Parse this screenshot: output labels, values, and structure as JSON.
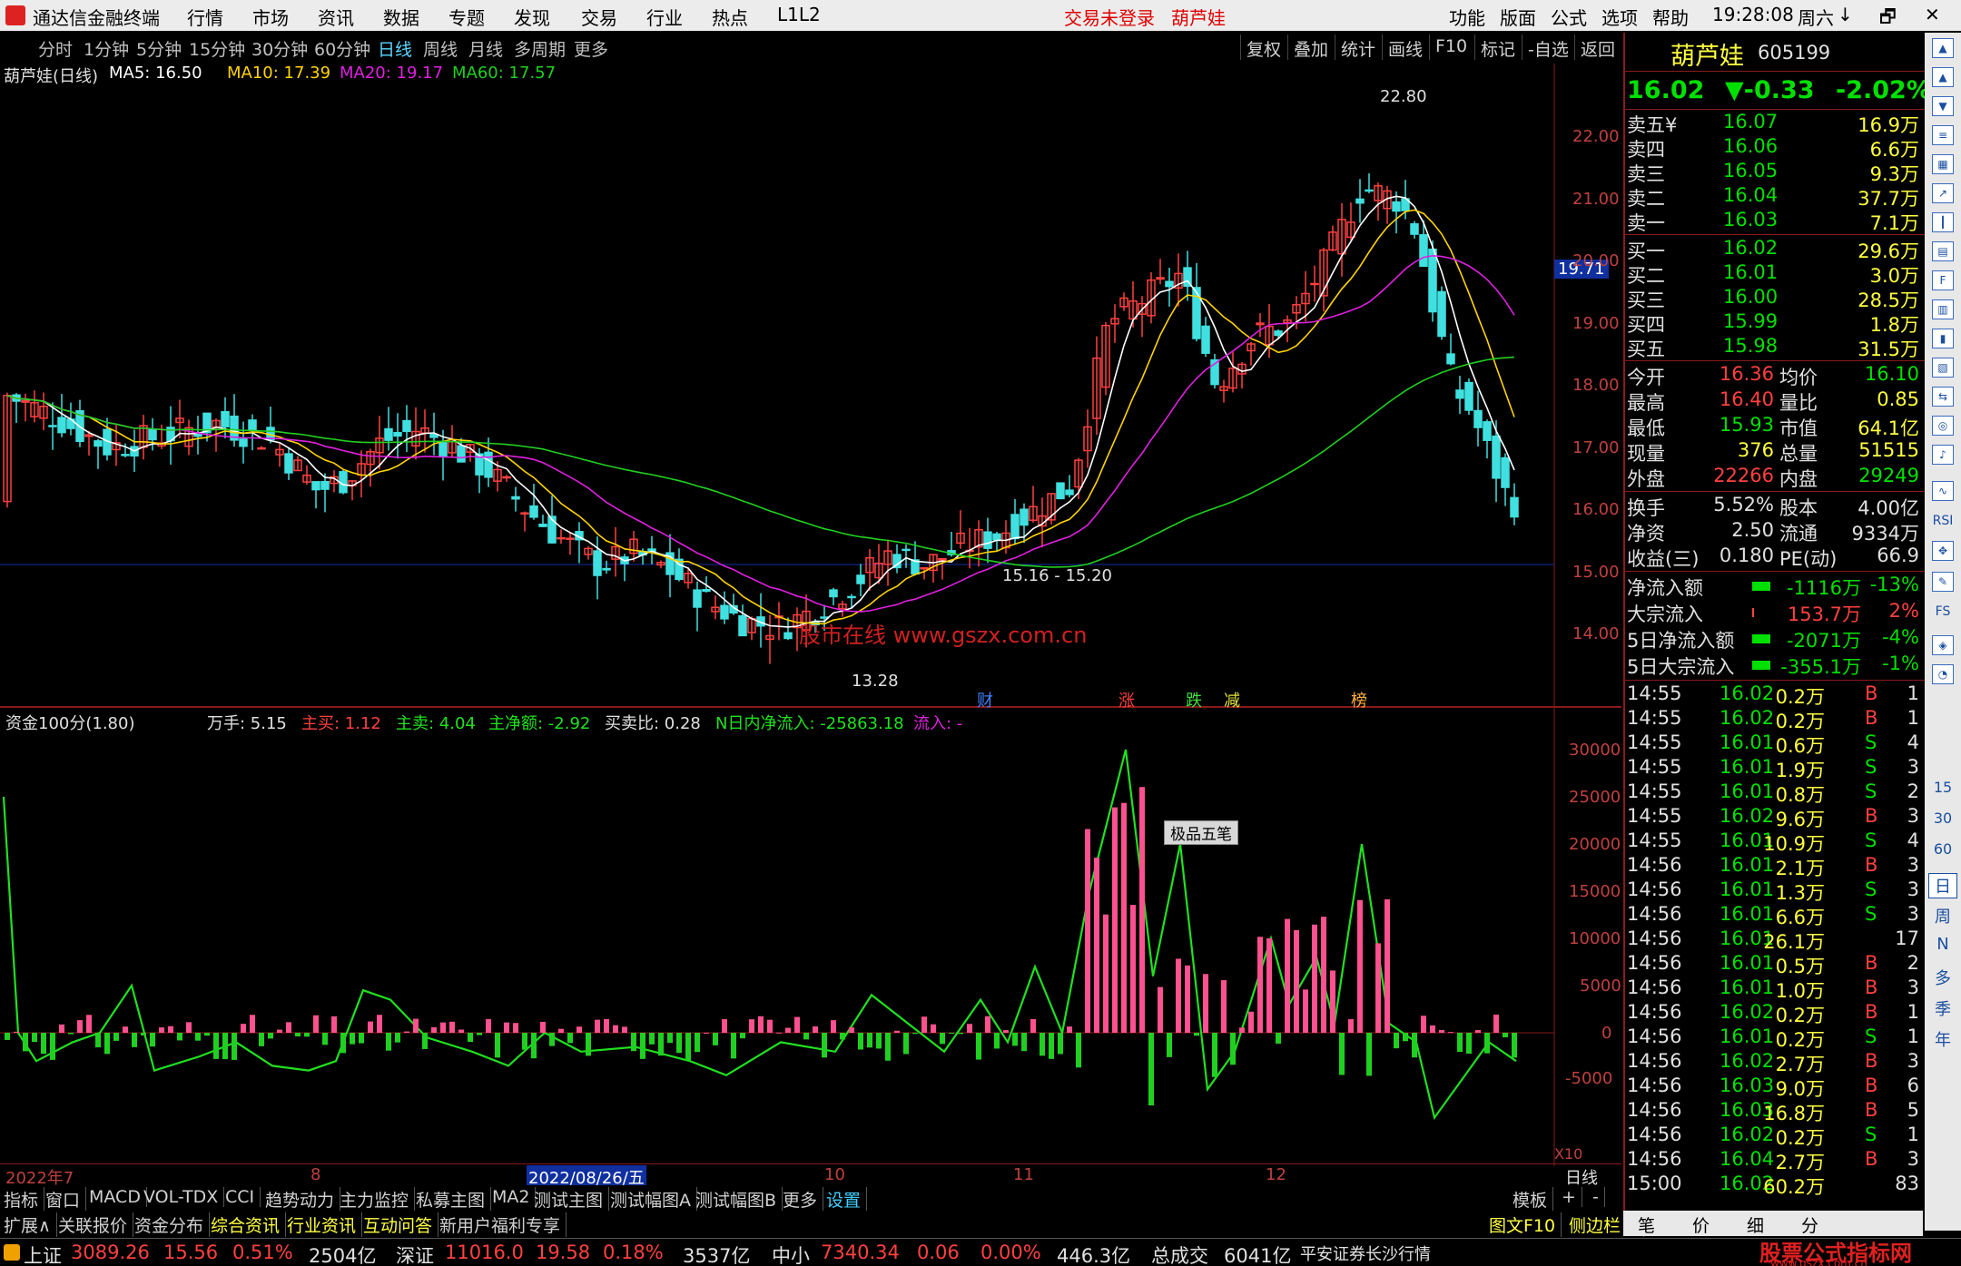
{
  "menubar": {
    "app_title": "通达信金融终端",
    "items": [
      "行情",
      "市场",
      "资讯",
      "数据",
      "专题",
      "发现",
      "交易",
      "行业",
      "热点",
      "L1L2"
    ],
    "status_login": "交易未登录",
    "stock_name": "葫芦娃",
    "right_items": [
      "功能",
      "版面",
      "公式",
      "选项",
      "帮助"
    ],
    "clock": "19:28:08",
    "weekday": "周六",
    "window_controls": [
      "↓",
      "🗗",
      "✕"
    ]
  },
  "periodbar": {
    "periods": [
      "分时",
      "1分钟",
      "5分钟",
      "15分钟",
      "30分钟",
      "60分钟",
      "日线",
      "周线",
      "月线",
      "多周期",
      "更多"
    ],
    "active": "日线",
    "tools": [
      "复权",
      "叠加",
      "统计",
      "画线",
      "F10",
      "标记",
      "-自选",
      "返回"
    ]
  },
  "main_legend": {
    "title": "葫芦娃(日线)",
    "ma5": "MA5: 16.50",
    "ma10": "MA10: 17.39",
    "ma20": "MA20: 19.17",
    "ma60": "MA60: 17.57",
    "high_label": "22.80",
    "low_label": "13.28",
    "range_label": "15.16 - 15.20",
    "price_tag": "19.71",
    "watermark": "股市在线  www.gszx.com.cn",
    "events": [
      "财",
      "涨",
      "跌",
      "减",
      "榜"
    ]
  },
  "sub_legend": {
    "title": "资金100分(1.80)",
    "wanshou": "万手: 5.15",
    "zhumai": "主买: 1.12",
    "zhumaichu": "主卖: 4.04",
    "jinge": "主净额: -2.92",
    "ratio": "买卖比: 0.28",
    "nday": "N日内净流入: -25863.18",
    "liuru": "流入: -",
    "popup": "极品五笔",
    "x10": "X10"
  },
  "axes": {
    "price_ticks": [
      "22.00",
      "21.00",
      "20.00",
      "19.00",
      "18.00",
      "17.00",
      "16.00",
      "15.00",
      "14.00"
    ],
    "flow_ticks": [
      "30000",
      "25000",
      "20000",
      "15000",
      "10000",
      "5000",
      "0",
      "-5000"
    ],
    "date_labels": [
      "2022年7",
      "8",
      "2022/08/26/五",
      "10",
      "11",
      "12",
      "日线"
    ]
  },
  "stock": {
    "name": "葫芦娃",
    "code": "605199",
    "price": "16.02",
    "change": "▼-0.33",
    "pct": "-2.02%"
  },
  "asks": [
    {
      "label": "卖五¥",
      "price": "16.07",
      "vol": "16.9万"
    },
    {
      "label": "卖四",
      "price": "16.06",
      "vol": "6.6万"
    },
    {
      "label": "卖三",
      "price": "16.05",
      "vol": "9.3万"
    },
    {
      "label": "卖二",
      "price": "16.04",
      "vol": "37.7万"
    },
    {
      "label": "卖一",
      "price": "16.03",
      "vol": "7.1万"
    }
  ],
  "bids": [
    {
      "label": "买一",
      "price": "16.02",
      "vol": "29.6万"
    },
    {
      "label": "买二",
      "price": "16.01",
      "vol": "3.0万"
    },
    {
      "label": "买三",
      "price": "16.00",
      "vol": "28.5万"
    },
    {
      "label": "买四",
      "price": "15.99",
      "vol": "1.8万"
    },
    {
      "label": "买五",
      "price": "15.98",
      "vol": "31.5万"
    }
  ],
  "quote": [
    {
      "k1": "今开",
      "v1": "16.36",
      "k2": "均价",
      "v2": "16.10"
    },
    {
      "k1": "最高",
      "v1": "16.40",
      "k2": "量比",
      "v2": "0.85"
    },
    {
      "k1": "最低",
      "v1": "15.93",
      "k2": "市值",
      "v2": "64.1亿"
    },
    {
      "k1": "现量",
      "v1": "376",
      "k2": "总量",
      "v2": "51515"
    },
    {
      "k1": "外盘",
      "v1": "22266",
      "k2": "内盘",
      "v2": "29249"
    }
  ],
  "fund": [
    {
      "k1": "换手",
      "v1": "5.52%",
      "k2": "股本",
      "v2": "4.00亿"
    },
    {
      "k1": "净资",
      "v1": "2.50",
      "k2": "流通",
      "v2": "9334万"
    },
    {
      "k1": "收益(三)",
      "v1": "0.180",
      "k2": "PE(动)",
      "v2": "66.9"
    }
  ],
  "flows": [
    {
      "k": "净流入额",
      "v": "-1116万",
      "p": "-13%"
    },
    {
      "k": "大宗流入",
      "v": "153.7万",
      "p": "2%"
    },
    {
      "k": "5日净流入额",
      "v": "-2071万",
      "p": "-4%"
    },
    {
      "k": "5日大宗流入",
      "v": "-355.1万",
      "p": "-1%"
    }
  ],
  "ticks": [
    {
      "t": "14:55",
      "p": "16.02",
      "v": "0.2万",
      "d": "B",
      "n": "1"
    },
    {
      "t": "14:55",
      "p": "16.02",
      "v": "0.2万",
      "d": "B",
      "n": "1"
    },
    {
      "t": "14:55",
      "p": "16.01",
      "v": "0.6万",
      "d": "S",
      "n": "4"
    },
    {
      "t": "14:55",
      "p": "16.01",
      "v": "1.9万",
      "d": "S",
      "n": "3"
    },
    {
      "t": "14:55",
      "p": "16.01",
      "v": "0.8万",
      "d": "S",
      "n": "2"
    },
    {
      "t": "14:55",
      "p": "16.02",
      "v": "9.6万",
      "d": "B",
      "n": "3"
    },
    {
      "t": "14:55",
      "p": "16.01",
      "v": "10.9万",
      "d": "S",
      "n": "4"
    },
    {
      "t": "14:56",
      "p": "16.01",
      "v": "2.1万",
      "d": "B",
      "n": "3"
    },
    {
      "t": "14:56",
      "p": "16.01",
      "v": "1.3万",
      "d": "S",
      "n": "3"
    },
    {
      "t": "14:56",
      "p": "16.01",
      "v": "6.6万",
      "d": "S",
      "n": "3"
    },
    {
      "t": "14:56",
      "p": "16.01",
      "v": "26.1万",
      "d": "",
      "n": "17"
    },
    {
      "t": "14:56",
      "p": "16.01",
      "v": "0.5万",
      "d": "B",
      "n": "2"
    },
    {
      "t": "14:56",
      "p": "16.01",
      "v": "1.0万",
      "d": "B",
      "n": "3"
    },
    {
      "t": "14:56",
      "p": "16.02",
      "v": "0.2万",
      "d": "B",
      "n": "1"
    },
    {
      "t": "14:56",
      "p": "16.01",
      "v": "0.2万",
      "d": "S",
      "n": "1"
    },
    {
      "t": "14:56",
      "p": "16.02",
      "v": "2.7万",
      "d": "B",
      "n": "3"
    },
    {
      "t": "14:56",
      "p": "16.03",
      "v": "9.0万",
      "d": "B",
      "n": "6"
    },
    {
      "t": "14:56",
      "p": "16.03",
      "v": "16.8万",
      "d": "B",
      "n": "5"
    },
    {
      "t": "14:56",
      "p": "16.02",
      "v": "0.2万",
      "d": "S",
      "n": "1"
    },
    {
      "t": "14:56",
      "p": "16.04",
      "v": "2.7万",
      "d": "B",
      "n": "3"
    },
    {
      "t": "15:00",
      "p": "16.02",
      "v": "60.2万",
      "d": "",
      "n": "83"
    }
  ],
  "tabs": [
    "指标",
    "窗口",
    "MACD",
    "VOL-TDX",
    "CCI",
    "趋势动力",
    "主力监控",
    "私募主图",
    "MA2",
    "测试主图",
    "测试幅图A",
    "测试幅图B",
    "更多",
    "设置"
  ],
  "tab_right": [
    "模板",
    "+",
    "-"
  ],
  "ext_tabs": [
    "扩展∧",
    "关联报价",
    "资金分布",
    "综合资讯",
    "行业资讯",
    "互动问答",
    "新用户福利专享"
  ],
  "ext_right": [
    "图文F10",
    "侧边栏《",
    "笔",
    "价",
    "细",
    "分"
  ],
  "statusbar": {
    "sh_label": "上证",
    "sh_val": "3089.26",
    "sh_chg": "15.56",
    "sh_pct": "0.51%",
    "sh_amt": "2504亿",
    "sz_label": "深证",
    "sz_val": "11016.0",
    "sz_chg": "19.58",
    "sz_pct": "0.18%",
    "sz_amt": "3537亿",
    "zx_label": "中小",
    "zx_val": "7340.34",
    "zx_chg": "0.06",
    "zx_pct": "0.00%",
    "zx_amt": "446.3亿",
    "total_label": "总成交",
    "total_amt": "6041亿",
    "broker": "平安证券长沙行情",
    "logo": "股票公式指标网",
    "logo_url": "www.gszx.com.cn"
  },
  "side_icons": [
    "RSI",
    "FS",
    "15",
    "30",
    "60",
    "日",
    "周",
    "N",
    "多",
    "季",
    "年"
  ],
  "colors": {
    "up": "#ff4040",
    "down": "#00e000",
    "ma5": "#ffffff",
    "ma10": "#ffd400",
    "ma20": "#e020e0",
    "ma60": "#20d020",
    "candle_down": "#40e0e0",
    "flow_line_up": "#e020e0",
    "flow_line_dn": "#20e020",
    "bar_pos": "#ff5090",
    "bar_neg": "#20d020"
  }
}
